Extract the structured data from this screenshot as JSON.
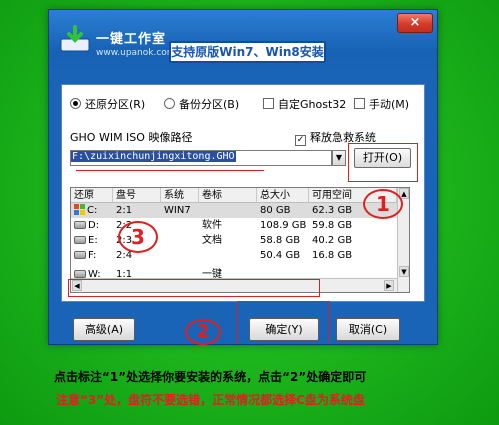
{
  "app": {
    "brand_title": "一键工作室",
    "brand_url": "www.upanok.com",
    "slogan": "支持原版Win7、Win8安装",
    "close_icon": "×"
  },
  "modes": {
    "restore": "还原分区(R)",
    "backup": "备份分区(B)",
    "custom_ghost": "自定Ghost32",
    "manual": "手动(M)",
    "selected": "restore"
  },
  "path": {
    "label": "GHO WIM ISO 映像路径",
    "release_label": "释放急救系统",
    "release_checked": true,
    "value": "F:\\zuixinchunjingxitong.GHO",
    "open_button": "打开(O)"
  },
  "table": {
    "headers": [
      "还原",
      "盘号",
      "系统",
      "卷标",
      "总大小",
      "可用空间"
    ],
    "rows": [
      {
        "drive": "C:",
        "disk": "2:1",
        "system": "WIN7",
        "label": "",
        "total": "80 GB",
        "free": "62.3 GB",
        "selected": true
      },
      {
        "drive": "D:",
        "disk": "2:2",
        "system": "",
        "label": "软件",
        "total": "108.9 GB",
        "free": "59.8 GB",
        "selected": false
      },
      {
        "drive": "E:",
        "disk": "2:3",
        "system": "",
        "label": "文档",
        "total": "58.8 GB",
        "free": "40.2 GB",
        "selected": false
      },
      {
        "drive": "F:",
        "disk": "2:4",
        "system": "",
        "label": "",
        "total": "50.4 GB",
        "free": "16.8 GB",
        "selected": false
      },
      {
        "drive": "W:",
        "disk": "1:1",
        "system": "",
        "label": "一键",
        "total": "",
        "free": "",
        "selected": false
      }
    ]
  },
  "buttons": {
    "advanced": "高级(A)",
    "ok": "确定(Y)",
    "cancel": "取消(C)"
  },
  "annotations": {
    "circle1": "1",
    "circle2": "2",
    "circle3": "3",
    "color": "#e02020"
  },
  "notes": {
    "line1": "点击标注“1”处选择你要安装的系统，点击“2”处确定即可",
    "line2": "注意“3”处，盘符不要选错，正常情况都选择C盘为系统盘"
  }
}
